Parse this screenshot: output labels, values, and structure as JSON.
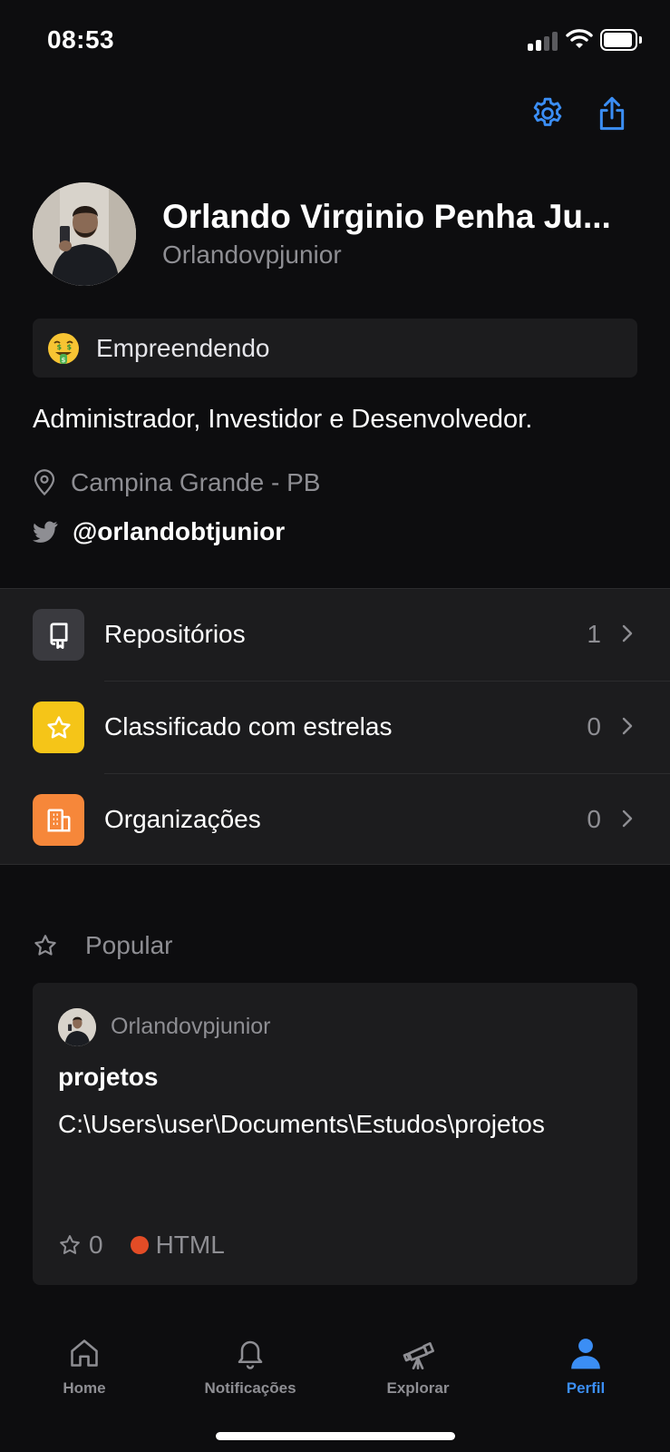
{
  "status_bar": {
    "time": "08:53",
    "signal_bars": 2,
    "battery_level": 0.85
  },
  "colors": {
    "accent": "#3b8ef5",
    "background": "#0d0d0f",
    "card": "#1c1c1e",
    "secondary_text": "#8e8e93",
    "repositories_icon_bg": "#3a3a3f",
    "starred_icon_bg": "#f5c518",
    "organizations_icon_bg": "#f6873a",
    "html_language": "#e34c26"
  },
  "header_actions": {
    "settings_icon": "gear-icon",
    "share_icon": "share-icon"
  },
  "profile": {
    "display_name": "Orlando Virginio Penha Ju...",
    "login": "Orlandovpjunior",
    "status_emoji": "money-mouth-face",
    "status_text": "Empreendendo",
    "bio": "Administrador, Investidor e Desenvolvedor.",
    "location": "Campina Grande - PB",
    "twitter": "@orlandobtjunior"
  },
  "menu": {
    "items": [
      {
        "label": "Repositórios",
        "count": "1",
        "icon": "repo-icon"
      },
      {
        "label": "Classificado com estrelas",
        "count": "0",
        "icon": "star-icon"
      },
      {
        "label": "Organizações",
        "count": "0",
        "icon": "organization-icon"
      }
    ]
  },
  "popular": {
    "title": "Popular",
    "repo": {
      "owner": "Orlandovpjunior",
      "name": "projetos",
      "description": "C:\\Users\\user\\Documents\\Estudos\\projetos",
      "stars": "0",
      "language": "HTML"
    }
  },
  "tabs": [
    {
      "label": "Home",
      "icon": "home-icon",
      "active": false
    },
    {
      "label": "Notificações",
      "icon": "bell-icon",
      "active": false
    },
    {
      "label": "Explorar",
      "icon": "telescope-icon",
      "active": false
    },
    {
      "label": "Perfil",
      "icon": "person-icon",
      "active": true
    }
  ]
}
